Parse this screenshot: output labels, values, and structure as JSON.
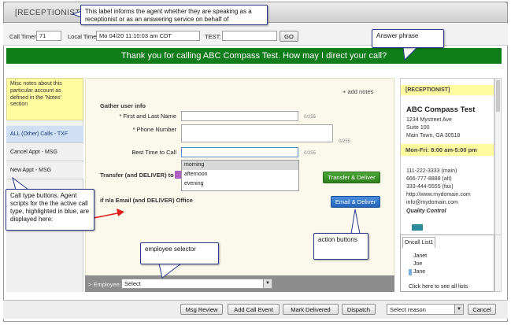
{
  "window": {
    "title": "[RECEPTIONIST]"
  },
  "toolbar": {
    "call_timer_label": "Call Timer:",
    "call_timer_value": "71",
    "local_time_label": "Local Time:",
    "local_time_value": "Mo 04/20 11:10:03 am CDT",
    "test_label": "TEST:",
    "test_value": "",
    "go_label": "GO"
  },
  "greeting": "Thank you for calling ABC Compass Test. How may I direct your call?",
  "misc_notes": "Misc notes about this particular account as defined in the 'Notes' section",
  "call_types": [
    {
      "label": "ALL (Other) Calls - TXF",
      "active": true
    },
    {
      "label": "Cancel Appt - MSG",
      "active": false
    },
    {
      "label": "New Appt - MSG",
      "active": false
    }
  ],
  "form": {
    "add_notes": "+ add notes",
    "section_title": "Gather user info",
    "fields": [
      {
        "label": "* First and Last Name",
        "count": "0/255"
      },
      {
        "label": "* Phone Number",
        "count": "0/255"
      },
      {
        "label": "Best Time to Call",
        "count": "0/255"
      }
    ],
    "dropdown_options": [
      "morning",
      "afternoon",
      "evening"
    ],
    "transfer_label": "Transfer (and DELIVER) to",
    "transfer_button": "Transfer & Deliver",
    "email_label": "if n/a Email (and DELIVER) Office",
    "email_button": "Email & Deliver",
    "employee_label": "> Employee:",
    "employee_select": "Select"
  },
  "account": {
    "tag": "[RECEPTIONIST]",
    "name": "ABC Compass Test",
    "address": [
      "1234 Mystreet Ave",
      "Suite 100",
      "Main Town, GA 30518"
    ],
    "hours": "Mon-Fri: 8:00 am-5:00 pm",
    "contacts": [
      "111-222-3333 (main)",
      "666-777-8888 (alt)",
      "333-444-5555 (fax)",
      "http://www.mydomain.com",
      "info@mydomain.com"
    ],
    "quality": "Quality Control"
  },
  "oncall": {
    "tab": "Oncall List1",
    "names": [
      "Janet",
      "Joe",
      "Jane"
    ],
    "link": "Click here to see all lists"
  },
  "bottom": {
    "msg_review": "Msg Review",
    "add_call_event": "Add Call Event",
    "mark_delivered": "Mark Delivered",
    "dispatch": "Dispatch",
    "select_reason": "Select reason",
    "cancel": "Cancel"
  },
  "callouts": {
    "label_info": "This label informs the agent whether they are speaking as a receptionist or as an answering service on behalf of",
    "answer_phrase": "Answer phrase",
    "call_type_buttons": "Call type buttons.  Agent scripts for the the active call type, highlighted in blue, are displayed here:",
    "employee_selector": "employee selector",
    "action_buttons": "action buttons"
  },
  "colors": {
    "greeting_bg": "#0f7d1a",
    "active_calltype": "#cfe0f5",
    "notes_bg": "#fefba0",
    "transfer_btn": "#2d7e1c",
    "email_btn": "#2664b8"
  }
}
